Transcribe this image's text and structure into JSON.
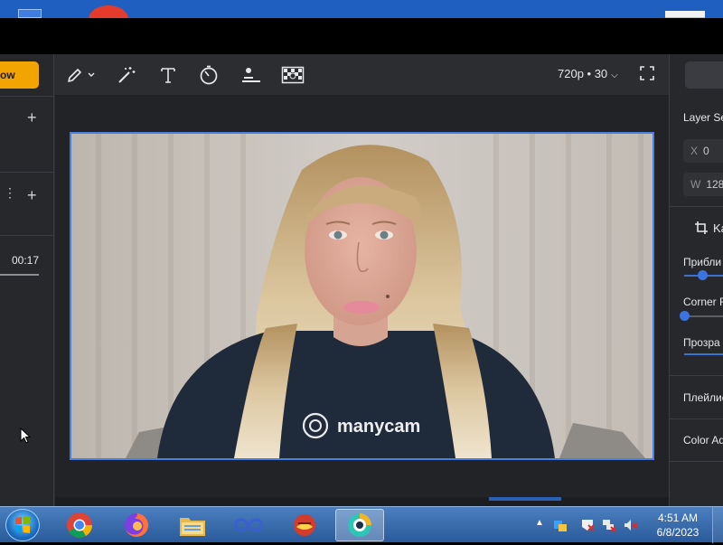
{
  "app": {
    "go_button_label": "ow",
    "left_panel": {
      "time": "00:17"
    },
    "toolbar": {
      "resolution": "720p • 30",
      "tools": [
        "pen-icon",
        "magic-wand-icon",
        "text-icon",
        "timer-icon",
        "lower-third-icon",
        "background-icon",
        "fullscreen-icon"
      ]
    },
    "video": {
      "watermark": "manycam"
    },
    "right_panel": {
      "layer_settings": "Layer Se",
      "x_label": "X",
      "x_value": "0",
      "w_label": "W",
      "w_value": "128",
      "crop_label": "Ka",
      "zoom_label": "Прибли",
      "zoom_value": 0.45,
      "corner_label": "Corner R",
      "corner_value": 0.0,
      "opacity_label": "Прозра",
      "opacity_value": 1.0,
      "playlist_label": "Плейлис",
      "color_label": "Color Ad"
    }
  },
  "taskbar": {
    "apps": [
      "chrome-icon",
      "firefox-icon",
      "explorer-icon",
      "infinity-app-icon",
      "red-app-icon",
      "manycam-icon"
    ],
    "active_app": "manycam-icon",
    "time": "4:51 AM",
    "date": "6/8/2023"
  },
  "colors": {
    "accent": "#f2a500",
    "selection": "#4a7fe0",
    "panel": "#2b2d31"
  }
}
